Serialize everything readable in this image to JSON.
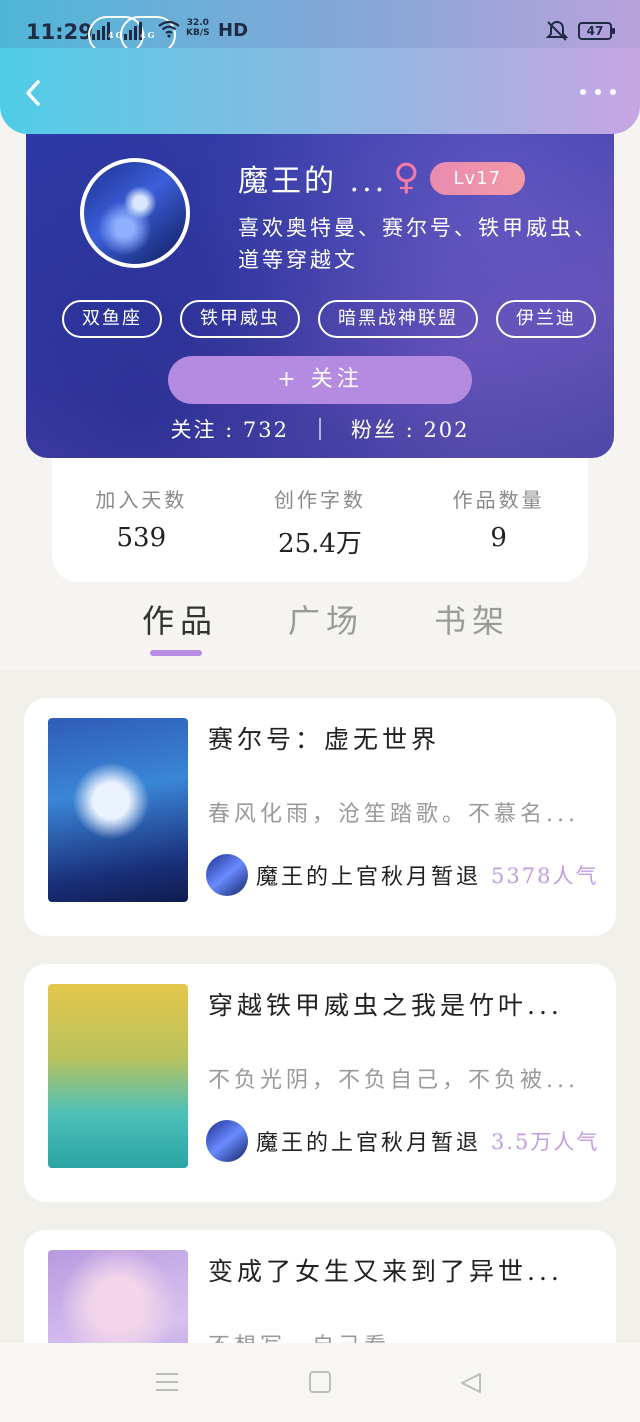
{
  "status_bar": {
    "time": "11:29",
    "net_speed_value": "32.0",
    "net_speed_unit": "KB/S",
    "hd_label": "HD",
    "battery": "47",
    "signal_tags": [
      "4G",
      "4G"
    ]
  },
  "header": {
    "back_icon": "chevron-left-icon",
    "more_icon": "more-dots-icon"
  },
  "profile": {
    "username": "魔王的 ...",
    "gender_symbol": "♀",
    "level": "Lv17",
    "bio": "喜欢奥特曼、赛尔号、铁甲威虫、\n道等穿越文",
    "tags": [
      "双鱼座",
      "铁甲威虫",
      "暗黑战神联盟",
      "伊兰迪"
    ],
    "follow_button": "+ 关注",
    "following_label": "关注",
    "following_count": "732",
    "fans_label": "粉丝",
    "fans_count": "202"
  },
  "stats": [
    {
      "label": "加入天数",
      "value": "539"
    },
    {
      "label": "创作字数",
      "value": "25.4万"
    },
    {
      "label": "作品数量",
      "value": "9"
    }
  ],
  "tabs": [
    {
      "label": "作品",
      "active": true
    },
    {
      "label": "广场",
      "active": false
    },
    {
      "label": "书架",
      "active": false
    }
  ],
  "works": [
    {
      "title": "赛尔号：虚无世界",
      "desc": "春风化雨，沧笙踏歌。不慕名...",
      "author": "魔王的上官秋月暂退",
      "popularity": "5378人气"
    },
    {
      "title": "穿越铁甲威虫之我是竹叶...",
      "desc": "不负光阴，不负自己，不负被...",
      "author": "魔王的上官秋月暂退",
      "popularity": "3.5万人气"
    },
    {
      "title": "变成了女生又来到了异世...",
      "desc": "不想写，自己看",
      "author": "",
      "popularity": ""
    }
  ],
  "colors": {
    "accent": "#b88ce3",
    "popularity": "#c49be0",
    "level_badge": "#ee90ac",
    "hero_blue": "#3a3fa8"
  }
}
